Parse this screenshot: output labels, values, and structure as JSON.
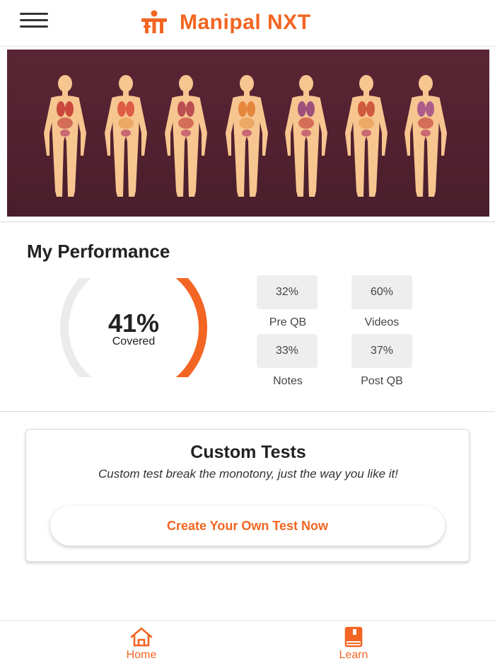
{
  "header": {
    "title": "Manipal NXT",
    "brand_color": "#f26522",
    "menu_icon": "hamburger-menu-icon",
    "logo_icon": "manipal-logo-icon"
  },
  "banner": {
    "image": "human-anatomy-organs-illustration",
    "background_color": "#4f2030"
  },
  "performance": {
    "title": "My Performance",
    "overall_percent_label": "41%",
    "overall_fraction": 0.41,
    "covered_label": "Covered",
    "ring_color": "#f26522",
    "stats": [
      {
        "value": "32%",
        "label": "Pre QB"
      },
      {
        "value": "60%",
        "label": "Videos"
      },
      {
        "value": "33%",
        "label": "Notes"
      },
      {
        "value": "37%",
        "label": "Post QB"
      }
    ]
  },
  "custom_tests": {
    "title": "Custom Tests",
    "description": "Custom test break the monotony, just the way you like it!",
    "cta_label": "Create Your Own Test Now"
  },
  "bottom_nav": {
    "items": [
      {
        "label": "Home",
        "icon": "home-icon"
      },
      {
        "label": "Learn",
        "icon": "book-icon"
      }
    ]
  }
}
